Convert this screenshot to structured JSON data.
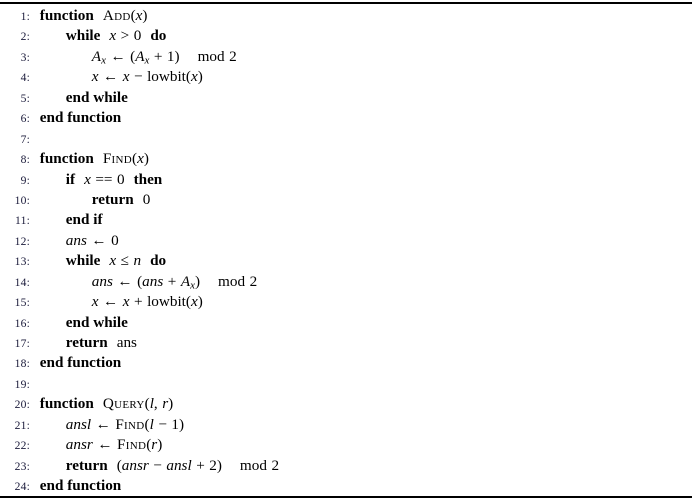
{
  "document": {
    "type": "algorithm-pseudocode",
    "line_count": 24,
    "rules": {
      "top": "horizontal-rule",
      "bottom": "horizontal-rule"
    }
  },
  "line_numbers": [
    "1:",
    "2:",
    "3:",
    "4:",
    "5:",
    "6:",
    "7:",
    "8:",
    "9:",
    "10:",
    "11:",
    "12:",
    "13:",
    "14:",
    "15:",
    "16:",
    "17:",
    "18:",
    "19:",
    "20:",
    "21:",
    "22:",
    "23:",
    "24:"
  ],
  "lines": [
    {
      "number": "1:",
      "indent": 0,
      "text": "function Add(x)"
    },
    {
      "number": "2:",
      "indent": 1,
      "text": "while x > 0 do"
    },
    {
      "number": "3:",
      "indent": 2,
      "text": "A_x ← (A_x + 1)  mod 2"
    },
    {
      "number": "4:",
      "indent": 2,
      "text": "x ← x − lowbit(x)"
    },
    {
      "number": "5:",
      "indent": 1,
      "text": "end while"
    },
    {
      "number": "6:",
      "indent": 0,
      "text": "end function"
    },
    {
      "number": "7:",
      "indent": 0,
      "text": ""
    },
    {
      "number": "8:",
      "indent": 0,
      "text": "function Find(x)"
    },
    {
      "number": "9:",
      "indent": 1,
      "text": "if x == 0 then"
    },
    {
      "number": "10:",
      "indent": 2,
      "text": "return 0"
    },
    {
      "number": "11:",
      "indent": 1,
      "text": "end if"
    },
    {
      "number": "12:",
      "indent": 1,
      "text": "ans ← 0"
    },
    {
      "number": "13:",
      "indent": 1,
      "text": "while x ≤ n do"
    },
    {
      "number": "14:",
      "indent": 2,
      "text": "ans ← (ans + A_x)  mod 2"
    },
    {
      "number": "15:",
      "indent": 2,
      "text": "x ← x + lowbit(x)"
    },
    {
      "number": "16:",
      "indent": 1,
      "text": "end while"
    },
    {
      "number": "17:",
      "indent": 1,
      "text": "return ans"
    },
    {
      "number": "18:",
      "indent": 0,
      "text": "end function"
    },
    {
      "number": "19:",
      "indent": 0,
      "text": ""
    },
    {
      "number": "20:",
      "indent": 0,
      "text": "function Query(l, r)"
    },
    {
      "number": "21:",
      "indent": 1,
      "text": "ansl ← Find(l − 1)"
    },
    {
      "number": "22:",
      "indent": 1,
      "text": "ansr ← Find(r)"
    },
    {
      "number": "23:",
      "indent": 1,
      "text": "return (ansr − ansl + 2)  mod 2"
    },
    {
      "number": "24:",
      "indent": 0,
      "text": "end function"
    }
  ],
  "tokens": {
    "kw_function": "function",
    "kw_end_function": "end function",
    "kw_while": "while",
    "kw_do": "do",
    "kw_end_while": "end while",
    "kw_if": "if",
    "kw_then": "then",
    "kw_end_if": "end if",
    "kw_return": "return",
    "kw_mod": "mod",
    "proc_add": "Add",
    "proc_find": "Find",
    "proc_query": "Query",
    "fn_lowbit": "lowbit",
    "var_x": "x",
    "var_n": "n",
    "var_l": "l",
    "var_r": "r",
    "var_A": "A",
    "var_ans": "ans",
    "var_ansl": "ansl",
    "var_ansr": "ansr",
    "num_0": "0",
    "num_1": "1",
    "num_2": "2",
    "op_assign": "←",
    "op_gt": ">",
    "op_le": "≤",
    "op_eq": "==",
    "op_plus": "+",
    "op_minus": "−",
    "paren_open": "(",
    "paren_close": ")",
    "comma": ",",
    "empty": ""
  },
  "colors": {
    "text": "#000000",
    "line_number": "#1a1a3a",
    "rule": "#000000",
    "background": "#ffffff"
  }
}
